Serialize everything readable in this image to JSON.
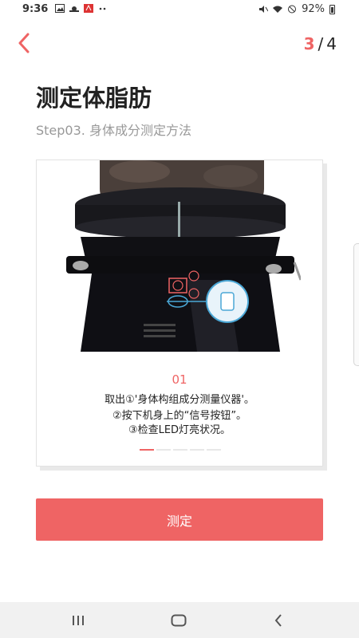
{
  "status_bar": {
    "time": "9:36",
    "battery": "92%"
  },
  "header": {
    "step_current": "3",
    "step_separator": "/",
    "step_total": "4"
  },
  "page": {
    "title": "测定体脂肪",
    "subtitle": "Step03. 身体成分测定方法"
  },
  "card": {
    "step_number": "01",
    "line1": "取出①'身体构组成分测量仪器'。",
    "line2": "②按下机身上的“信号按钮”。",
    "line3": "③检查LED灯亮状况。",
    "pager_count": 5,
    "pager_active": 0,
    "illustration_markers": [
      "①",
      "②"
    ]
  },
  "actions": {
    "measure_label": "测定"
  },
  "colors": {
    "accent": "#ef6464",
    "text": "#222222",
    "subtitle": "#999999",
    "nav_bg": "#f1f1f1"
  },
  "icons": {
    "back": "chevron-left-icon",
    "nav_recents": "recents-icon",
    "nav_home": "home-icon",
    "nav_back": "back-icon"
  }
}
